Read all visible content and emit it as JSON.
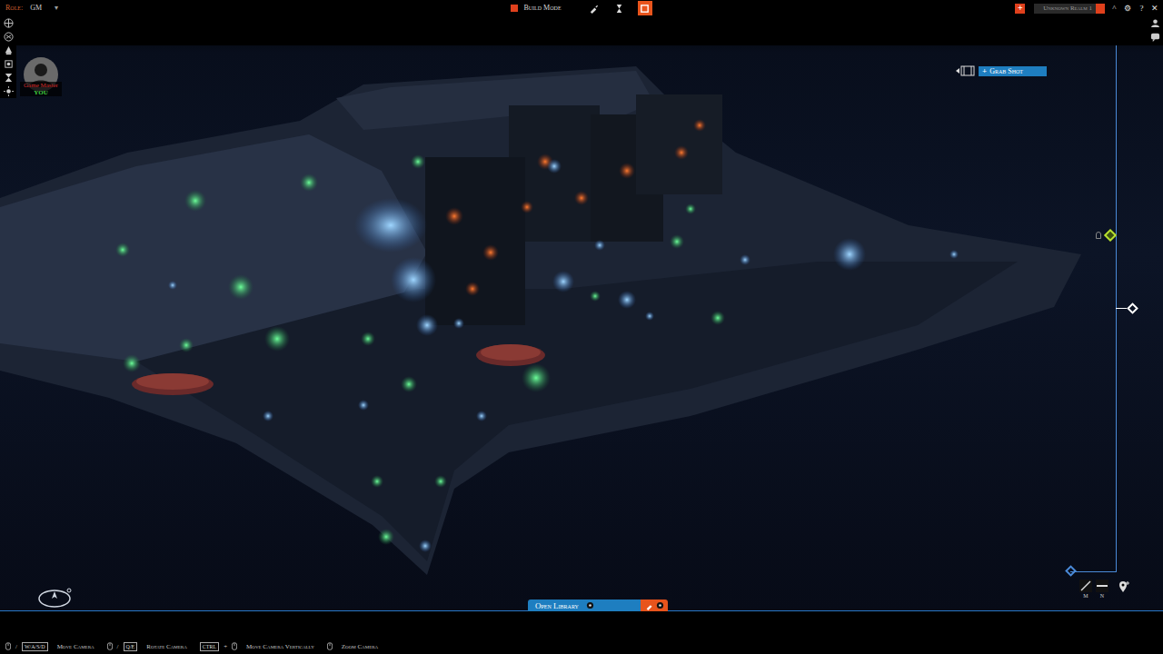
{
  "topbar": {
    "role_label": "Role:",
    "role": "GM",
    "role_caret": "▾",
    "mode": {
      "label": "Build Mode",
      "on": true
    },
    "tools": [
      {
        "selected": false
      },
      {
        "selected": false
      },
      {
        "selected": true
      }
    ],
    "add_glyph": "+",
    "realm": "Unknown Realm 1",
    "window_glyphs": [
      "^",
      "⚙",
      "?",
      "✕"
    ]
  },
  "player": {
    "name": "Game Master",
    "tag": "YOU"
  },
  "grab_shot": {
    "glyph": "+",
    "label": "Grab Shot"
  },
  "library": {
    "label": "Open Library"
  },
  "scale": {
    "labels": [
      "M",
      "N"
    ]
  },
  "hints": [
    {
      "label": "Move Camera",
      "parts": [
        {
          "kind": "mouse"
        },
        {
          "kind": "text",
          "text": "/"
        },
        {
          "kind": "key",
          "text": "W/A/S/D"
        }
      ]
    },
    {
      "label": "Rotate Camera",
      "parts": [
        {
          "kind": "mouse"
        },
        {
          "kind": "text",
          "text": "/"
        },
        {
          "kind": "key",
          "text": "Q/E"
        }
      ]
    },
    {
      "label": "Move Camera Vertically",
      "parts": [
        {
          "kind": "key",
          "text": "CTRL"
        },
        {
          "kind": "text",
          "text": "+"
        },
        {
          "kind": "mouse"
        }
      ]
    },
    {
      "label": "Zoom Camera",
      "parts": [
        {
          "kind": "mouse"
        }
      ]
    }
  ]
}
